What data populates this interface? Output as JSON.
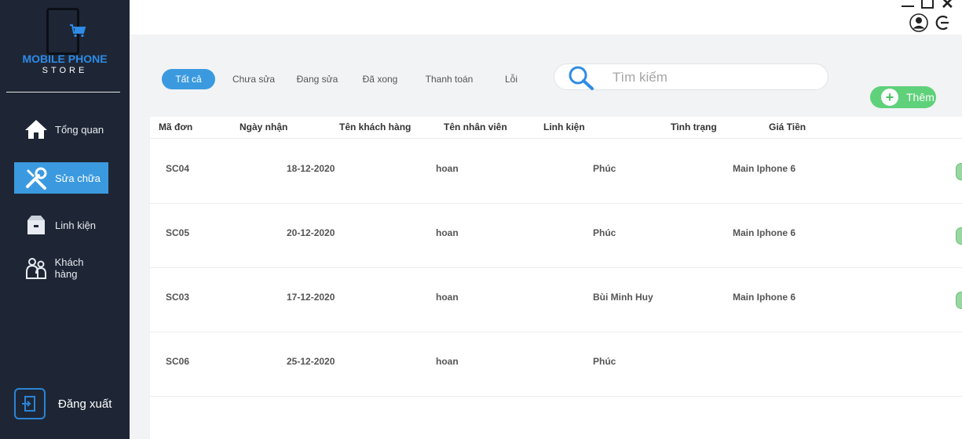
{
  "brand": {
    "line1": "MOBILE PHONE",
    "line2": "STORE"
  },
  "sidebar": {
    "items": [
      {
        "label": "Tổng quan",
        "icon": "home-icon"
      },
      {
        "label": "Sửa chữa",
        "icon": "tools-icon",
        "active": true
      },
      {
        "label": "Linh kiện",
        "icon": "box-icon"
      },
      {
        "label": "Khách hàng",
        "icon": "customers-icon"
      }
    ],
    "logout_label": "Đăng xuất"
  },
  "tabs": [
    {
      "label": "Tất cả",
      "active": true
    },
    {
      "label": "Chưa sửa"
    },
    {
      "label": "Đang sửa"
    },
    {
      "label": "Đã xong"
    },
    {
      "label": "Thanh toán"
    },
    {
      "label": "Lỗi"
    }
  ],
  "search": {
    "placeholder": "Tìm kiếm",
    "value": ""
  },
  "add_button": {
    "label": "Thêm"
  },
  "table": {
    "columns": [
      "Mã đơn",
      "Ngày nhận",
      "Tên khách hàng",
      "Tên nhân viên",
      "Linh kiện",
      "Tình trạng",
      "Giá Tiền"
    ],
    "rows": [
      {
        "id": "SC04",
        "date": "18-12-2020",
        "staff": "hoan",
        "customer": "Phúc",
        "part": "Main Iphone 6"
      },
      {
        "id": "SC05",
        "date": "20-12-2020",
        "staff": "hoan",
        "customer": "Phúc",
        "part": "Main Iphone 6"
      },
      {
        "id": "SC03",
        "date": "17-12-2020",
        "staff": "hoan",
        "customer": "Bùi Minh Huy",
        "part": "Main Iphone 6"
      },
      {
        "id": "SC06",
        "date": "25-12-2020",
        "staff": "hoan",
        "customer": "Phúc",
        "part": ""
      }
    ]
  },
  "colors": {
    "sidebar_bg": "#1e2635",
    "accent": "#3b9adf",
    "add_green": "#5fd17a"
  }
}
